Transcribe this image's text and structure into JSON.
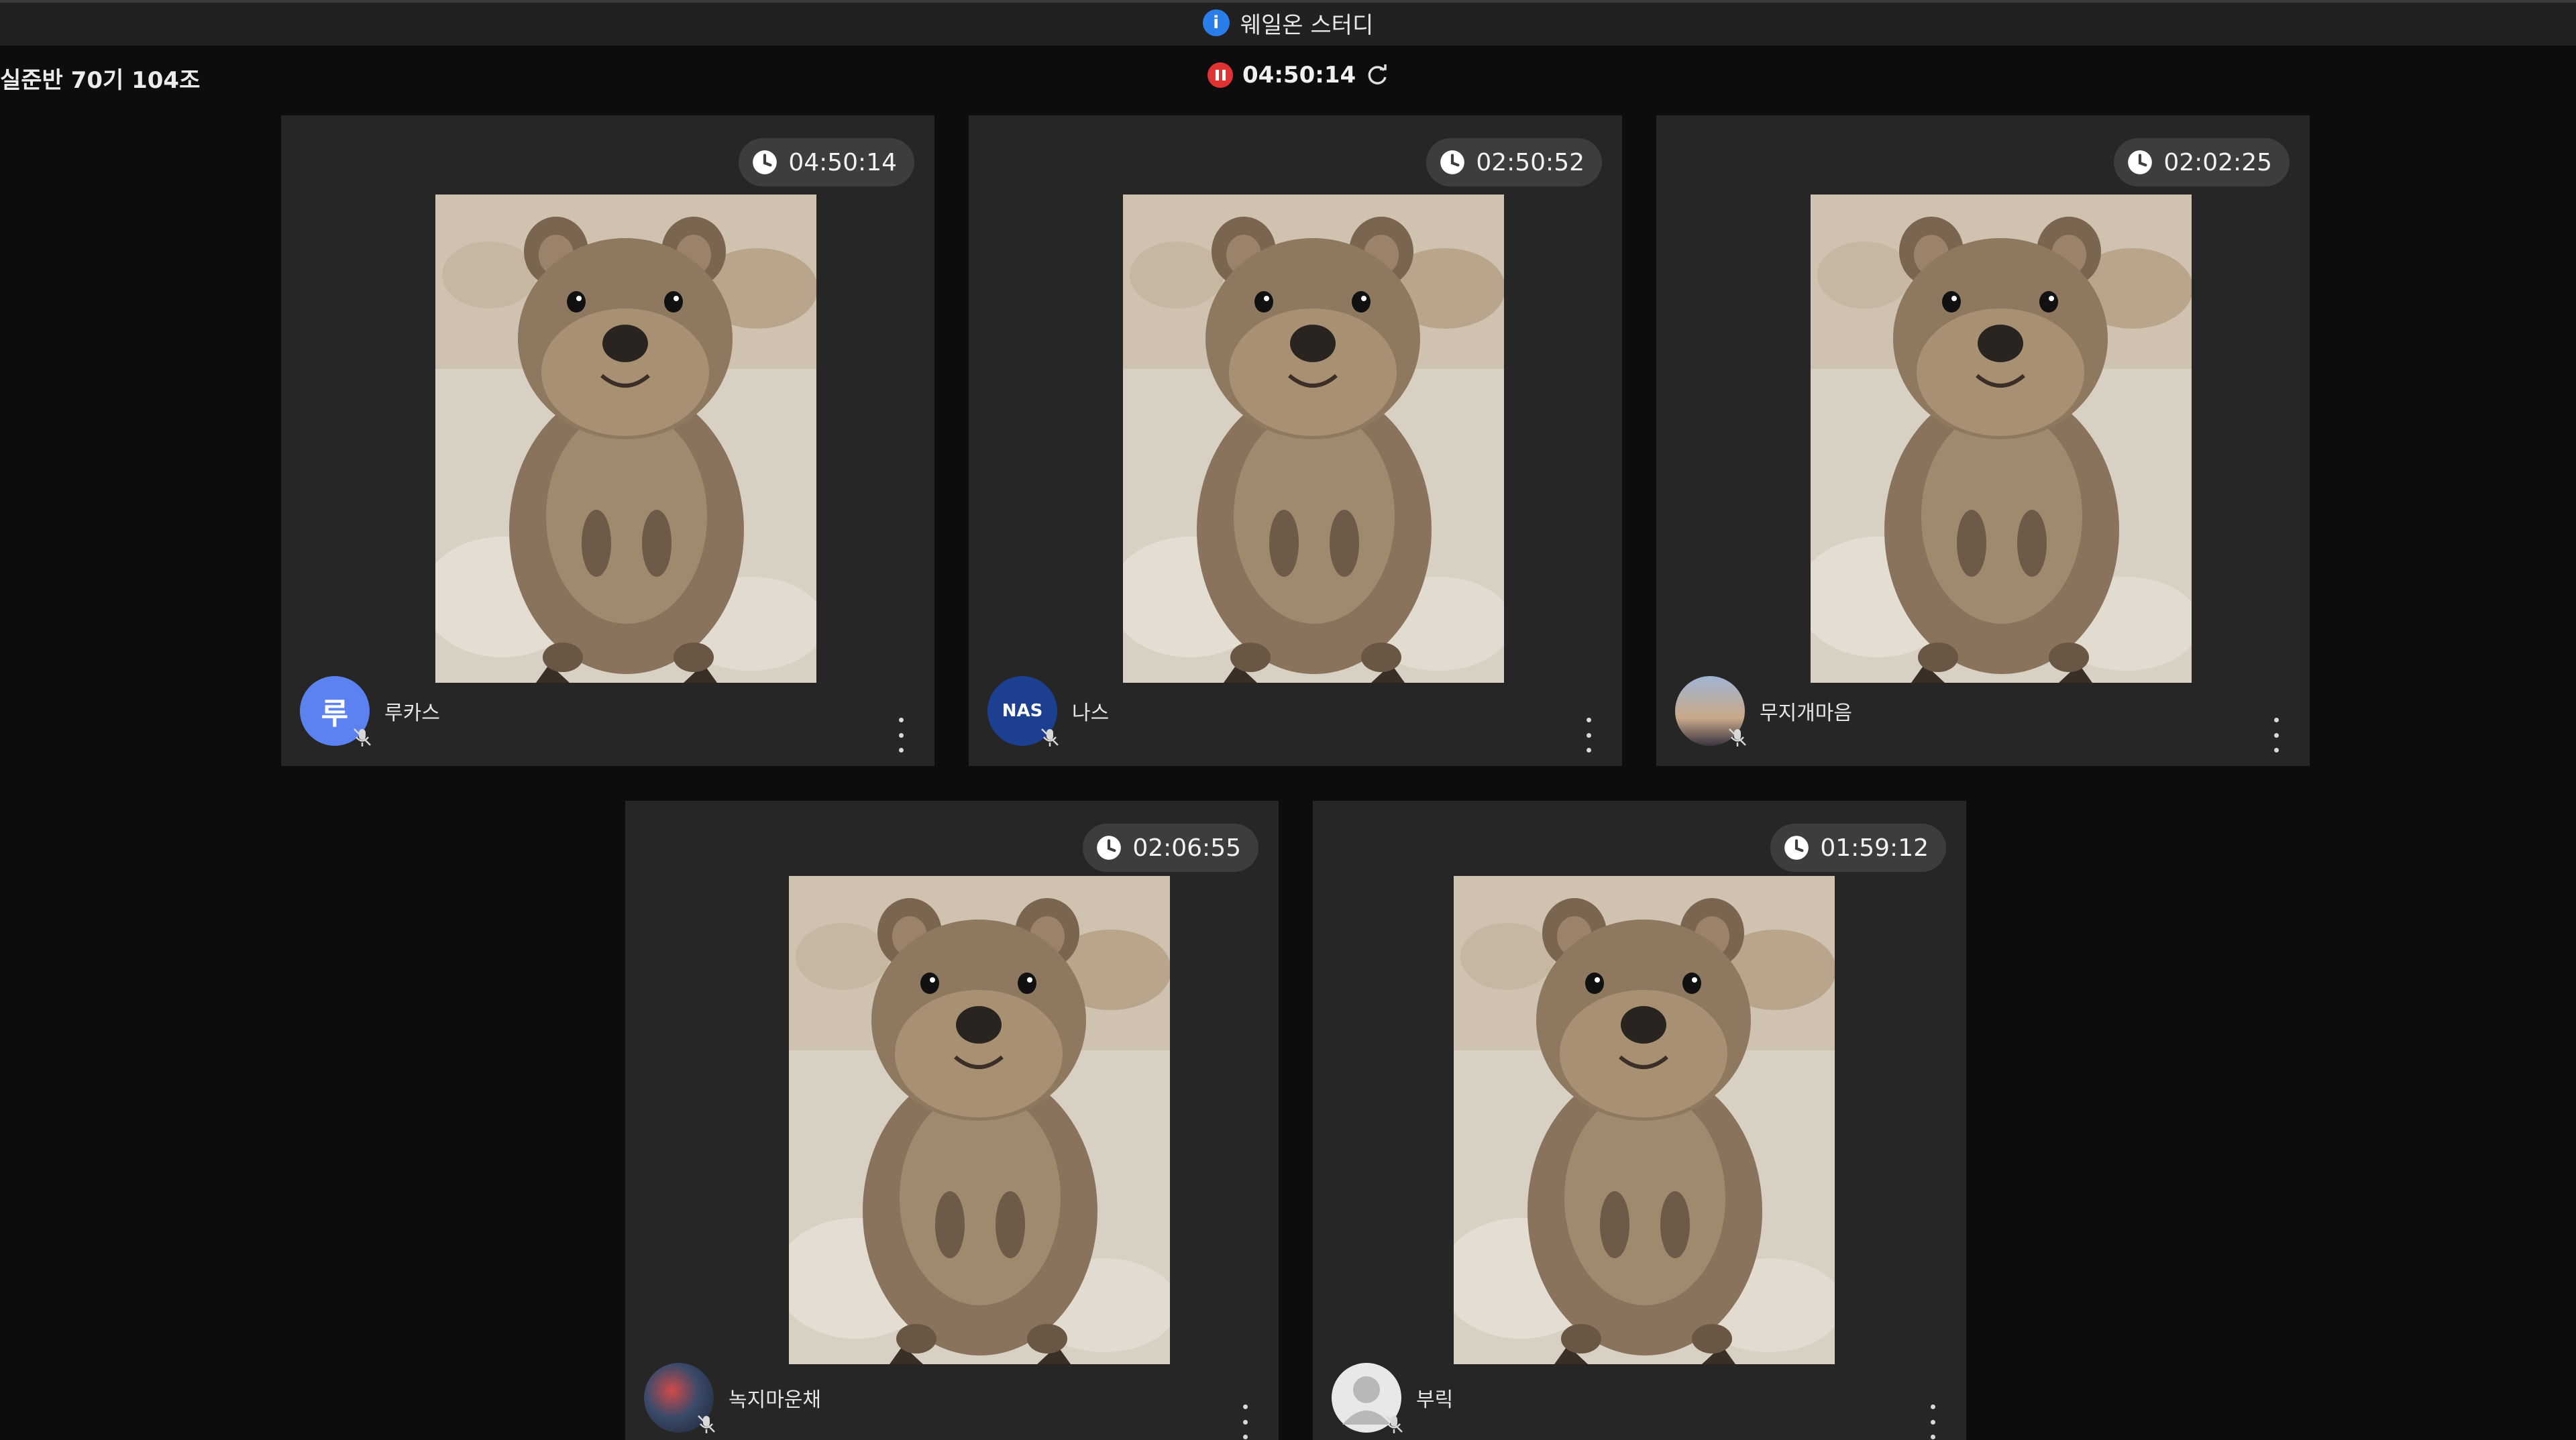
{
  "window": {
    "title": "웨일온 스터디"
  },
  "session": {
    "group_label": "실준반 70기 104조",
    "elapsed": "04:50:14"
  },
  "colors": {
    "background": "#0d0d0d",
    "card": "#262626",
    "badge": "#3d3d3d",
    "record": "#e03434",
    "info": "#2b7de9"
  },
  "participants": [
    {
      "name": "루카스",
      "timer": "04:50:14",
      "avatar_text": "루",
      "avatar_color": "#5b82f0"
    },
    {
      "name": "나스",
      "timer": "02:50:52",
      "avatar_text": "NAS",
      "avatar_color": "#1c3f8f"
    },
    {
      "name": "무지개마음",
      "timer": "02:02:25",
      "avatar_text": "",
      "avatar_color": "#8fa0b8"
    },
    {
      "name": "녹지마운채",
      "timer": "02:06:55",
      "avatar_text": "",
      "avatar_color": "#3a4a6a"
    },
    {
      "name": "부릭",
      "timer": "01:59:12",
      "avatar_text": "",
      "avatar_color": "#e8e8e8"
    }
  ]
}
